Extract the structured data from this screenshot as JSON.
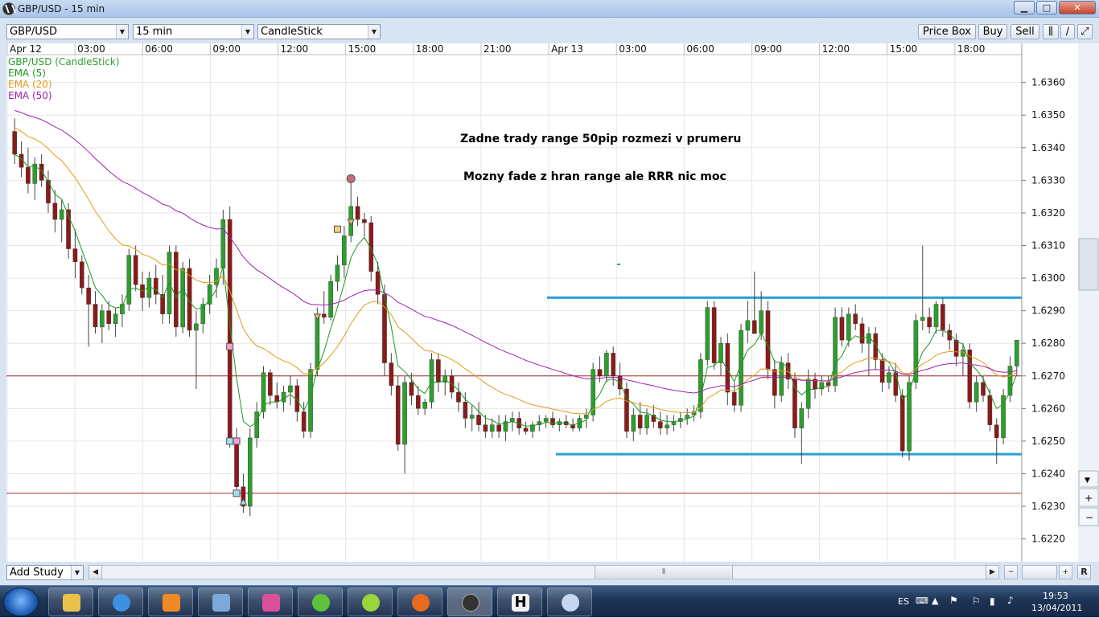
{
  "window": {
    "title": "GBP/USD - 15 min",
    "controls": [
      "minimize",
      "maximize",
      "close"
    ]
  },
  "toolbar": {
    "instrument": "GBP/USD",
    "interval": "15 min",
    "chart_type": "CandleStick",
    "price_box_label": "Price Box",
    "buy_label": "Buy",
    "sell_label": "Sell"
  },
  "legend": {
    "items": [
      {
        "label": "GBP/USD (CandleStick)",
        "color": "#2e9e2e"
      },
      {
        "label": "EMA (5)",
        "color": "#1c9a1c"
      },
      {
        "label": "EMA (20)",
        "color": "#e39b18"
      },
      {
        "label": "EMA (50)",
        "color": "#a020b0"
      }
    ]
  },
  "annotations": {
    "line1": "Zadne trady range 50pip rozmezi v prumeru",
    "line2": "Mozny fade z hran range ale RRR nic moc"
  },
  "chart_data": {
    "type": "candlestick",
    "symbol": "GBP/USD",
    "timeframe": "15 min",
    "x_tick_labels": [
      "Apr 12",
      "03:00",
      "06:00",
      "09:00",
      "12:00",
      "15:00",
      "18:00",
      "21:00",
      "Apr 13",
      "03:00",
      "06:00",
      "09:00",
      "12:00",
      "15:00",
      "18:00"
    ],
    "y_tick_labels": [
      "1.6360",
      "1.6350",
      "1.6340",
      "1.6330",
      "1.6320",
      "1.6310",
      "1.6300",
      "1.6290",
      "1.6280",
      "1.6270",
      "1.6260",
      "1.6250",
      "1.6240",
      "1.6230",
      "1.6220"
    ],
    "ylim": [
      1.6213,
      1.6372
    ],
    "candles": [
      [
        1.6345,
        1.6349,
        1.6335,
        1.6338
      ],
      [
        1.6338,
        1.6342,
        1.6331,
        1.6334
      ],
      [
        1.6334,
        1.634,
        1.6326,
        1.6329
      ],
      [
        1.6329,
        1.6337,
        1.6324,
        1.6335
      ],
      [
        1.6335,
        1.6338,
        1.6328,
        1.633
      ],
      [
        1.633,
        1.6333,
        1.632,
        1.6323
      ],
      [
        1.6323,
        1.6327,
        1.6314,
        1.6318
      ],
      [
        1.6318,
        1.6324,
        1.6311,
        1.6321
      ],
      [
        1.6321,
        1.6323,
        1.6306,
        1.6309
      ],
      [
        1.6309,
        1.6315,
        1.63,
        1.6305
      ],
      [
        1.6305,
        1.6307,
        1.6295,
        1.6297
      ],
      [
        1.6297,
        1.6301,
        1.6279,
        1.6292
      ],
      [
        1.6292,
        1.6296,
        1.6283,
        1.6285
      ],
      [
        1.6285,
        1.6292,
        1.628,
        1.629
      ],
      [
        1.629,
        1.6293,
        1.6284,
        1.6286
      ],
      [
        1.6286,
        1.6291,
        1.6282,
        1.6289
      ],
      [
        1.6289,
        1.6295,
        1.6285,
        1.6292
      ],
      [
        1.6292,
        1.6309,
        1.629,
        1.6307
      ],
      [
        1.6307,
        1.631,
        1.6296,
        1.6298
      ],
      [
        1.6298,
        1.6302,
        1.629,
        1.6294
      ],
      [
        1.6294,
        1.6302,
        1.6291,
        1.63
      ],
      [
        1.63,
        1.6304,
        1.6292,
        1.6295
      ],
      [
        1.6295,
        1.6301,
        1.6286,
        1.6289
      ],
      [
        1.6289,
        1.631,
        1.6286,
        1.6308
      ],
      [
        1.6308,
        1.631,
        1.6282,
        1.6285
      ],
      [
        1.6285,
        1.6305,
        1.6283,
        1.6303
      ],
      [
        1.6303,
        1.6306,
        1.6282,
        1.6284
      ],
      [
        1.6284,
        1.629,
        1.6266,
        1.6286
      ],
      [
        1.6286,
        1.6294,
        1.6283,
        1.6292
      ],
      [
        1.6292,
        1.6301,
        1.6289,
        1.6298
      ],
      [
        1.6298,
        1.6306,
        1.6294,
        1.6303
      ],
      [
        1.6303,
        1.6321,
        1.6298,
        1.6318
      ],
      [
        1.6318,
        1.6322,
        1.6248,
        1.625
      ],
      [
        1.625,
        1.6254,
        1.6233,
        1.6236
      ],
      [
        1.6236,
        1.624,
        1.6228,
        1.623
      ],
      [
        1.623,
        1.6254,
        1.6227,
        1.6251
      ],
      [
        1.6251,
        1.6262,
        1.6248,
        1.6259
      ],
      [
        1.6259,
        1.6273,
        1.6257,
        1.6271
      ],
      [
        1.6271,
        1.6272,
        1.6261,
        1.6264
      ],
      [
        1.6264,
        1.6268,
        1.626,
        1.6262
      ],
      [
        1.6262,
        1.6267,
        1.6259,
        1.6265
      ],
      [
        1.6265,
        1.627,
        1.6261,
        1.6267
      ],
      [
        1.6267,
        1.6269,
        1.6256,
        1.6259
      ],
      [
        1.6259,
        1.6262,
        1.6251,
        1.6253
      ],
      [
        1.6253,
        1.6274,
        1.6251,
        1.6272
      ],
      [
        1.6272,
        1.6291,
        1.627,
        1.6289
      ],
      [
        1.6289,
        1.6296,
        1.6286,
        1.6288
      ],
      [
        1.6288,
        1.6301,
        1.6287,
        1.6299
      ],
      [
        1.6299,
        1.6307,
        1.6296,
        1.6304
      ],
      [
        1.6304,
        1.6316,
        1.63,
        1.6313
      ],
      [
        1.6313,
        1.633,
        1.6311,
        1.6322
      ],
      [
        1.6322,
        1.6325,
        1.6316,
        1.6318
      ],
      [
        1.6318,
        1.632,
        1.6312,
        1.6317
      ],
      [
        1.6317,
        1.6319,
        1.6299,
        1.6302
      ],
      [
        1.6302,
        1.6305,
        1.6292,
        1.6295
      ],
      [
        1.6295,
        1.6298,
        1.627,
        1.6274
      ],
      [
        1.6274,
        1.6277,
        1.6264,
        1.6267
      ],
      [
        1.6267,
        1.627,
        1.6247,
        1.6249
      ],
      [
        1.6249,
        1.627,
        1.624,
        1.6268
      ],
      [
        1.6268,
        1.6271,
        1.6261,
        1.6264
      ],
      [
        1.6264,
        1.6267,
        1.6258,
        1.626
      ],
      [
        1.626,
        1.6263,
        1.6258,
        1.6262
      ],
      [
        1.6262,
        1.6277,
        1.626,
        1.6275
      ],
      [
        1.6275,
        1.6277,
        1.6265,
        1.6268
      ],
      [
        1.6268,
        1.6272,
        1.6264,
        1.627
      ],
      [
        1.627,
        1.6272,
        1.6263,
        1.6265
      ],
      [
        1.6265,
        1.6268,
        1.6259,
        1.6262
      ],
      [
        1.6262,
        1.6265,
        1.6254,
        1.6257
      ],
      [
        1.6257,
        1.6261,
        1.6253,
        1.6258
      ],
      [
        1.6258,
        1.6262,
        1.6253,
        1.6255
      ],
      [
        1.6255,
        1.6258,
        1.6251,
        1.6253
      ],
      [
        1.6253,
        1.6257,
        1.6251,
        1.6255
      ],
      [
        1.6255,
        1.6258,
        1.6251,
        1.6253
      ],
      [
        1.6253,
        1.6258,
        1.625,
        1.6256
      ],
      [
        1.6256,
        1.6259,
        1.6253,
        1.6257
      ],
      [
        1.6257,
        1.6259,
        1.6252,
        1.6254
      ],
      [
        1.6254,
        1.6256,
        1.6252,
        1.6253
      ],
      [
        1.6253,
        1.6256,
        1.6251,
        1.6255
      ],
      [
        1.6255,
        1.6258,
        1.6253,
        1.6256
      ],
      [
        1.6256,
        1.6258,
        1.6254,
        1.6257
      ],
      [
        1.6257,
        1.6259,
        1.6254,
        1.6255
      ],
      [
        1.6255,
        1.6257,
        1.6253,
        1.6256
      ],
      [
        1.6256,
        1.6258,
        1.6254,
        1.6255
      ],
      [
        1.6255,
        1.6257,
        1.6253,
        1.6254
      ],
      [
        1.6254,
        1.6258,
        1.6253,
        1.6257
      ],
      [
        1.6257,
        1.626,
        1.6254,
        1.6258
      ],
      [
        1.6258,
        1.6274,
        1.6256,
        1.6272
      ],
      [
        1.6272,
        1.6276,
        1.6268,
        1.627
      ],
      [
        1.627,
        1.6278,
        1.6268,
        1.6277
      ],
      [
        1.6277,
        1.6279,
        1.6267,
        1.627
      ],
      [
        1.627,
        1.6274,
        1.6264,
        1.6266
      ],
      [
        1.6266,
        1.6268,
        1.6251,
        1.6253
      ],
      [
        1.6253,
        1.626,
        1.625,
        1.6258
      ],
      [
        1.6258,
        1.6262,
        1.6252,
        1.6254
      ],
      [
        1.6254,
        1.626,
        1.6252,
        1.6258
      ],
      [
        1.6258,
        1.6261,
        1.6254,
        1.6256
      ],
      [
        1.6256,
        1.6259,
        1.6252,
        1.6254
      ],
      [
        1.6254,
        1.6258,
        1.6252,
        1.6255
      ],
      [
        1.6255,
        1.6258,
        1.6253,
        1.6256
      ],
      [
        1.6256,
        1.6259,
        1.6254,
        1.6257
      ],
      [
        1.6257,
        1.626,
        1.6255,
        1.6258
      ],
      [
        1.6258,
        1.6261,
        1.6256,
        1.6259
      ],
      [
        1.6259,
        1.6277,
        1.6257,
        1.6275
      ],
      [
        1.6275,
        1.6293,
        1.6273,
        1.6291
      ],
      [
        1.6291,
        1.6293,
        1.6272,
        1.6274
      ],
      [
        1.6274,
        1.6282,
        1.627,
        1.628
      ],
      [
        1.628,
        1.6283,
        1.6261,
        1.6265
      ],
      [
        1.6265,
        1.6268,
        1.6259,
        1.6261
      ],
      [
        1.6261,
        1.6286,
        1.6259,
        1.6284
      ],
      [
        1.6284,
        1.6293,
        1.628,
        1.6287
      ],
      [
        1.6287,
        1.6302,
        1.6283,
        1.6283
      ],
      [
        1.6283,
        1.6296,
        1.6281,
        1.629
      ],
      [
        1.629,
        1.6293,
        1.6269,
        1.6272
      ],
      [
        1.6272,
        1.6275,
        1.626,
        1.6264
      ],
      [
        1.6264,
        1.6276,
        1.6262,
        1.6274
      ],
      [
        1.6274,
        1.6277,
        1.6266,
        1.6269
      ],
      [
        1.6269,
        1.6271,
        1.6251,
        1.6254
      ],
      [
        1.6254,
        1.6262,
        1.6243,
        1.626
      ],
      [
        1.626,
        1.6272,
        1.6257,
        1.6269
      ],
      [
        1.6269,
        1.6271,
        1.6263,
        1.6266
      ],
      [
        1.6266,
        1.627,
        1.6264,
        1.6268
      ],
      [
        1.6268,
        1.627,
        1.6265,
        1.6267
      ],
      [
        1.6267,
        1.6291,
        1.6265,
        1.6288
      ],
      [
        1.6288,
        1.6291,
        1.6279,
        1.6281
      ],
      [
        1.6281,
        1.6291,
        1.6279,
        1.6289
      ],
      [
        1.6289,
        1.6292,
        1.6284,
        1.6286
      ],
      [
        1.6286,
        1.6288,
        1.6277,
        1.628
      ],
      [
        1.628,
        1.6285,
        1.627,
        1.6283
      ],
      [
        1.6283,
        1.6285,
        1.6272,
        1.6275
      ],
      [
        1.6275,
        1.6277,
        1.6265,
        1.6268
      ],
      [
        1.6268,
        1.6273,
        1.6266,
        1.6271
      ],
      [
        1.6271,
        1.6274,
        1.6262,
        1.6264
      ],
      [
        1.6264,
        1.6266,
        1.6245,
        1.6247
      ],
      [
        1.6247,
        1.627,
        1.6244,
        1.6268
      ],
      [
        1.6268,
        1.6289,
        1.6266,
        1.6287
      ],
      [
        1.6287,
        1.631,
        1.6284,
        1.6288
      ],
      [
        1.6288,
        1.6291,
        1.6283,
        1.6285
      ],
      [
        1.6285,
        1.6293,
        1.6283,
        1.6292
      ],
      [
        1.6292,
        1.6294,
        1.6282,
        1.6284
      ],
      [
        1.6284,
        1.6286,
        1.6278,
        1.6281
      ],
      [
        1.6281,
        1.6283,
        1.6273,
        1.6276
      ],
      [
        1.6276,
        1.628,
        1.627,
        1.6278
      ],
      [
        1.6278,
        1.628,
        1.626,
        1.6262
      ],
      [
        1.6262,
        1.627,
        1.6259,
        1.6268
      ],
      [
        1.6268,
        1.627,
        1.6262,
        1.6264
      ],
      [
        1.6264,
        1.6266,
        1.6253,
        1.6255
      ],
      [
        1.6255,
        1.6257,
        1.6243,
        1.6251
      ],
      [
        1.6251,
        1.6266,
        1.6249,
        1.6264
      ],
      [
        1.6264,
        1.6276,
        1.6262,
        1.6273
      ],
      [
        1.6273,
        1.6281,
        1.627,
        1.6281
      ]
    ],
    "ema_period_5_color": "#1c9a1c",
    "ema_period_20_color": "#e39b18",
    "ema_period_50_color": "#a020b0",
    "horizontal_lines": [
      {
        "price": 1.627,
        "color": "#a52a2a"
      },
      {
        "price": 1.6234,
        "color": "#a52a2a"
      },
      {
        "price": 1.6294,
        "color": "#2aa0d8"
      },
      {
        "price": 1.6246,
        "color": "#2aa0d8"
      }
    ],
    "grid": true
  },
  "bottom": {
    "add_study_label": "Add Study"
  },
  "taskbar": {
    "apps": [
      "explorer-icon",
      "ie-icon",
      "media-player-icon",
      "control-panel-icon",
      "games-icon",
      "icq-icon",
      "ninjatrader-icon",
      "firefox-icon",
      "ninja-dark-icon",
      "h-app-icon",
      "paint-icon"
    ],
    "language": "ES",
    "time": "19:53",
    "date": "13/04/2011"
  }
}
